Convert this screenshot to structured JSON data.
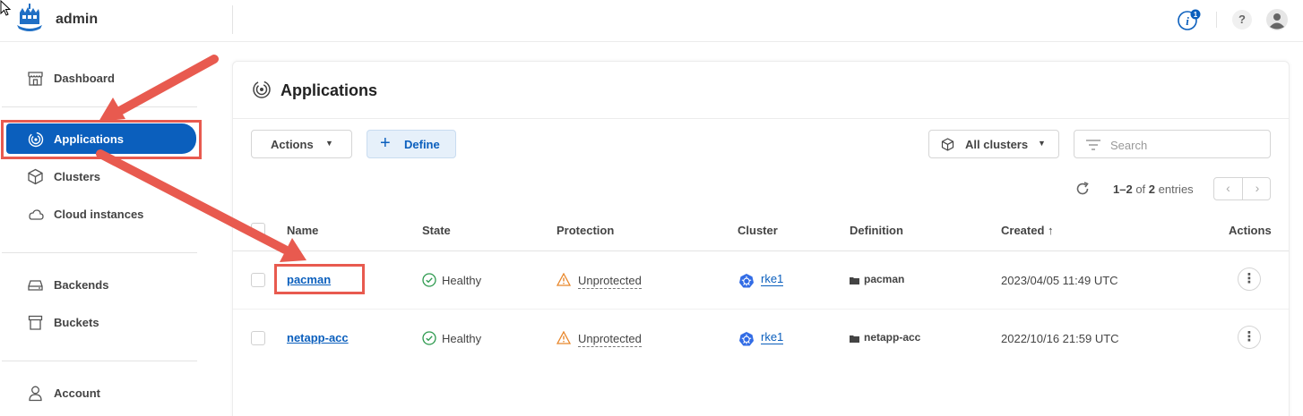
{
  "header": {
    "brand": "admin",
    "info_badge": "1",
    "help_glyph": "?",
    "icons": [
      "ship-logo-icon",
      "info-notification-icon",
      "help-icon",
      "user-avatar-icon"
    ]
  },
  "sidebar": {
    "items": [
      {
        "label": "Dashboard",
        "icon": "dashboard-icon"
      },
      {
        "label": "Applications",
        "icon": "applications-icon",
        "active": true
      },
      {
        "label": "Clusters",
        "icon": "cube-icon"
      },
      {
        "label": "Cloud instances",
        "icon": "cloud-icon"
      },
      {
        "label": "Backends",
        "icon": "storage-icon"
      },
      {
        "label": "Buckets",
        "icon": "bucket-icon"
      },
      {
        "label": "Account",
        "icon": "user-icon"
      }
    ]
  },
  "main": {
    "title": "Applications",
    "toolbar": {
      "actions_label": "Actions",
      "define_label": "Define",
      "clusters_label": "All clusters",
      "search_placeholder": "Search"
    },
    "pagination": {
      "range": "1–2",
      "of": "of",
      "total": "2",
      "unit": "entries"
    },
    "columns": [
      "Name",
      "State",
      "Protection",
      "Cluster",
      "Definition",
      "Created ↑",
      "Actions"
    ],
    "rows": [
      {
        "name": "pacman",
        "state": "Healthy",
        "protection": "Unprotected",
        "cluster": "rke1",
        "definition": "pacman",
        "created": "2023/04/05 11:49 UTC"
      },
      {
        "name": "netapp-acc",
        "state": "Healthy",
        "protection": "Unprotected",
        "cluster": "rke1",
        "definition": "netapp-acc",
        "created": "2022/10/16 21:59 UTC"
      }
    ]
  },
  "colors": {
    "accent": "#0b5fbd",
    "annotation": "#e85a4f",
    "healthy": "#2e9a4f",
    "warning": "#e8862a"
  }
}
